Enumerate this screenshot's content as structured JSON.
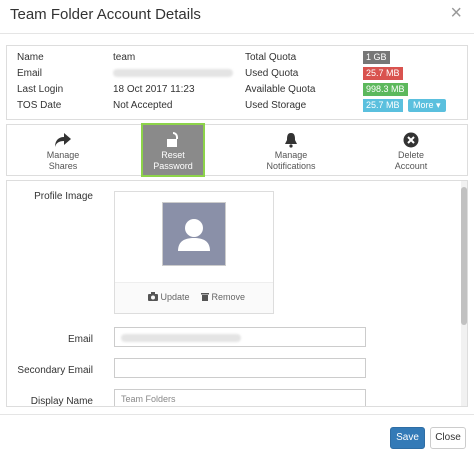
{
  "dialog": {
    "title": "Team Folder Account Details",
    "close_glyph": "×"
  },
  "info": {
    "name_label": "Name",
    "name_value": "team",
    "email_label": "Email",
    "last_login_label": "Last Login",
    "last_login_value": "18 Oct 2017 11:23",
    "tos_label": "TOS Date",
    "tos_value": "Not Accepted",
    "total_quota_label": "Total Quota",
    "total_quota_value": "1 GB",
    "used_quota_label": "Used Quota",
    "used_quota_value": "25.7 MB",
    "available_quota_label": "Available Quota",
    "available_quota_value": "998.3 MB",
    "used_storage_label": "Used Storage",
    "used_storage_value": "25.7 MB",
    "more_label": "More ▾",
    "colors": {
      "total": "#777777",
      "used": "#d9534f",
      "available": "#5cb85c",
      "storage": "#5bc0de"
    }
  },
  "toolbar": {
    "manage_shares": "Manage\nShares",
    "reset_password": "Reset\nPassword",
    "manage_notifications": "Manage\nNotifications",
    "delete_account": "Delete\nAccount"
  },
  "form": {
    "profile_image_label": "Profile Image",
    "update_label": "Update",
    "remove_label": "Remove",
    "email_label": "Email",
    "secondary_email_label": "Secondary Email",
    "display_name_label": "Display Name",
    "display_name_value": "Team Folders"
  },
  "footer": {
    "save_label": "Save",
    "close_label": "Close"
  }
}
